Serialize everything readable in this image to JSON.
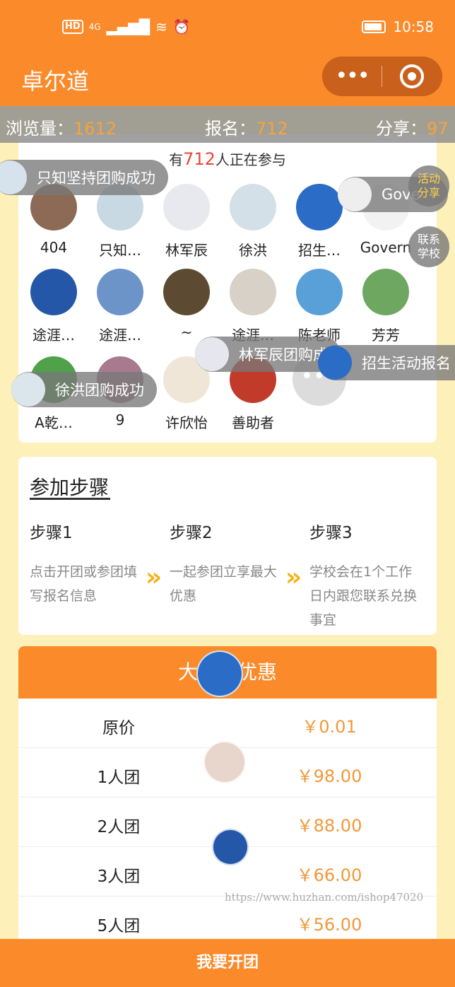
{
  "status": {
    "time": "10:58",
    "hd": "HD",
    "network": "4G"
  },
  "navbar": {
    "title": "卓尔道",
    "more_icon": "•••",
    "close_icon": "target"
  },
  "stats": [
    {
      "label": "浏览量：",
      "value": "1612"
    },
    {
      "label": "报名：",
      "value": "712"
    },
    {
      "label": "分享：",
      "value": "97"
    }
  ],
  "join": {
    "prefix": "有",
    "count": "712",
    "suffix": "人正在参与",
    "members": [
      {
        "name": "404",
        "color": "#8c6a55"
      },
      {
        "name": "只知…",
        "color": "#c9d9e3"
      },
      {
        "name": "林军辰",
        "color": "#e8e8ef"
      },
      {
        "name": "徐洪",
        "color": "#d4e0e8"
      },
      {
        "name": "招生…",
        "color": "#2a6cc6"
      },
      {
        "name": "Govern",
        "color": "#f2f2f2"
      },
      {
        "name": "途涯…",
        "color": "#2457a8"
      },
      {
        "name": "途涯…",
        "color": "#6c94c9"
      },
      {
        "name": "~",
        "color": "#5c4a33"
      },
      {
        "name": "途涯…",
        "color": "#d8d1c8"
      },
      {
        "name": "陈老师",
        "color": "#5aa0d8"
      },
      {
        "name": "芳芳",
        "color": "#6ea860"
      },
      {
        "name": "A乾…",
        "color": "#4fa14a"
      },
      {
        "name": "9",
        "color": "#a87a8e"
      },
      {
        "name": "许欣怡",
        "color": "#f0e6d8"
      },
      {
        "name": "善助者",
        "color": "#c23a2a"
      }
    ],
    "more": "•••"
  },
  "toasts": [
    {
      "text": "只知坚持团购成功"
    },
    {
      "text": "Gove"
    },
    {
      "text": "林军辰团购成"
    },
    {
      "text": "招生活动报名"
    },
    {
      "text": "徐洪团购成功"
    }
  ],
  "side_buttons": [
    {
      "line1": "活动",
      "line2": "分享"
    },
    {
      "line1": "联系",
      "line2": "学校"
    }
  ],
  "steps": {
    "title": "参加步骤",
    "items": [
      {
        "title": "步骤1",
        "desc": "点击开团或参团填写报名信息"
      },
      {
        "title": "步骤2",
        "desc": "一起参团立享最大优惠"
      },
      {
        "title": "步骤3",
        "desc": "学校会在1个工作日内跟您联系兑换事宜"
      }
    ],
    "arrow": "»"
  },
  "pricing": {
    "title": "大团购优惠",
    "rows": [
      {
        "label": "原价",
        "price": "￥0.01"
      },
      {
        "label": "1人团",
        "price": "￥98.00"
      },
      {
        "label": "2人团",
        "price": "￥88.00"
      },
      {
        "label": "3人团",
        "price": "￥66.00"
      },
      {
        "label": "5人团",
        "price": "￥56.00"
      }
    ]
  },
  "watermark": "https://www.huzhan.com/ishop47020",
  "bottom": {
    "label": "我要开团"
  }
}
